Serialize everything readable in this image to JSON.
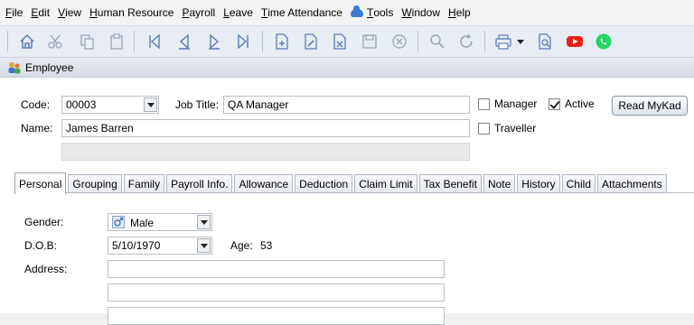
{
  "menubar": {
    "items": [
      {
        "label": "File",
        "underline": "F",
        "rest": "ile"
      },
      {
        "label": "Edit",
        "underline": "E",
        "rest": "dit"
      },
      {
        "label": "View",
        "underline": "V",
        "rest": "iew"
      },
      {
        "label": "Human Resource",
        "underline": "H",
        "rest": "uman Resource"
      },
      {
        "label": "Payroll",
        "underline": "P",
        "rest": "ayroll"
      },
      {
        "label": "Leave",
        "underline": "L",
        "rest": "eave"
      },
      {
        "label": "Time Attendance",
        "underline": "T",
        "rest": "ime Attendance"
      },
      {
        "label": "Tools",
        "underline": "T",
        "rest": "ools"
      },
      {
        "label": "Window",
        "underline": "W",
        "rest": "indow"
      },
      {
        "label": "Help",
        "underline": "H",
        "rest": "elp"
      }
    ]
  },
  "toolbar": {
    "icons": [
      "home-icon",
      "cut-icon",
      "copy-icon",
      "paste-icon",
      "first-record-icon",
      "previous-record-icon",
      "next-record-icon",
      "last-record-icon",
      "new-record-icon",
      "edit-record-icon",
      "delete-record-icon",
      "save-icon",
      "cancel-icon",
      "search-icon",
      "refresh-icon",
      "print-icon",
      "print-dropdown-icon",
      "preview-icon",
      "youtube-icon",
      "whatsapp-icon"
    ],
    "colors": {
      "icon": "#4a6fa8",
      "youtube": "#e62117",
      "whatsapp": "#25d366"
    }
  },
  "panel": {
    "title": "Employee"
  },
  "form": {
    "code_label": "Code:",
    "code_value": "00003",
    "job_title_label": "Job Title:",
    "job_title_value": "QA Manager",
    "name_label": "Name:",
    "name_value": "James Barren",
    "manager_label": "Manager",
    "manager_checked": false,
    "active_label": "Active",
    "active_checked": true,
    "traveller_label": "Traveller",
    "traveller_checked": false,
    "read_mykad_label": "Read MyKad"
  },
  "tabs": [
    "Personal",
    "Grouping",
    "Family",
    "Payroll Info.",
    "Allowance",
    "Deduction",
    "Claim Limit",
    "Tax Benefit",
    "Note",
    "History",
    "Child",
    "Attachments"
  ],
  "active_tab": "Personal",
  "personal": {
    "gender_label": "Gender:",
    "gender_value": "Male",
    "dob_label": "D.O.B:",
    "dob_value": "5/10/1970",
    "age_label": "Age:",
    "age_value": "53",
    "address_label": "Address:",
    "address_line1": "",
    "address_line2": "",
    "address_line3": ""
  }
}
